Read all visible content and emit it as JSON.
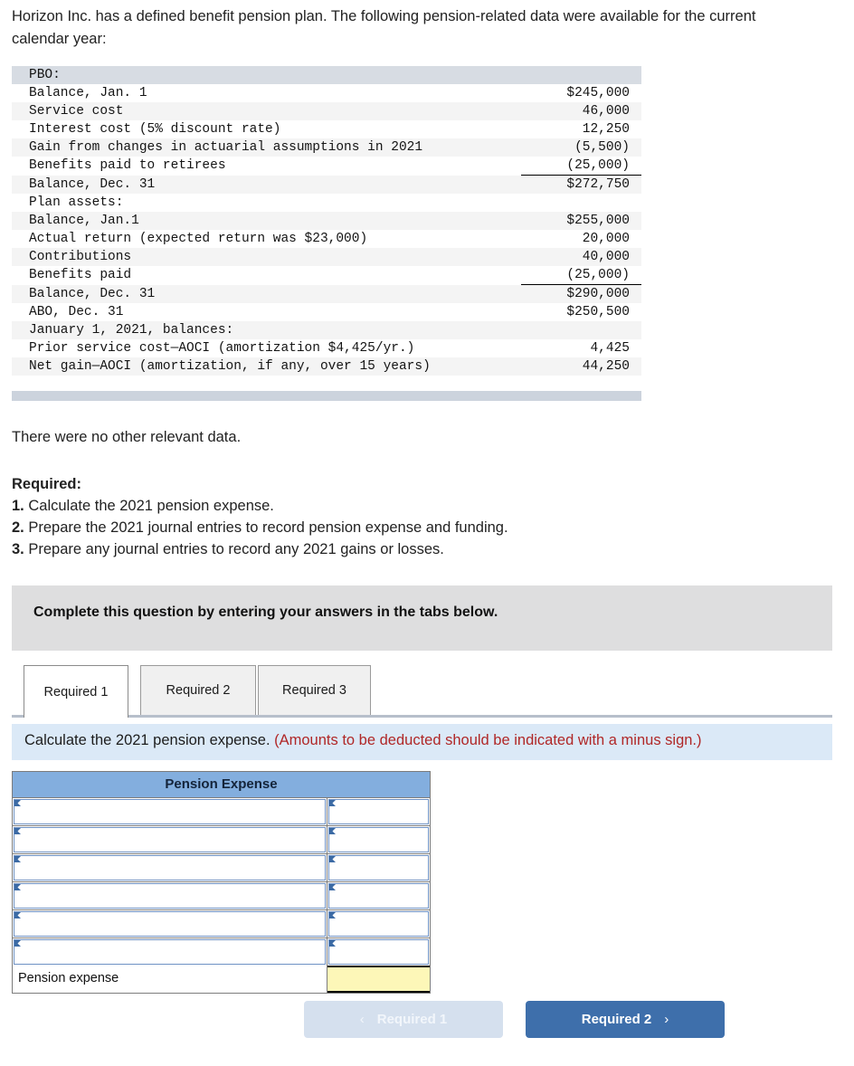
{
  "intro": "Horizon Inc. has a defined benefit pension plan. The following pension-related data were available for the current calendar year:",
  "data_table": {
    "rows": [
      {
        "label": "PBO:",
        "value": "",
        "band": "dark",
        "ruled": false
      },
      {
        "label": "Balance, Jan. 1",
        "value": "$245,000",
        "band": "white",
        "ruled": false
      },
      {
        "label": "Service cost",
        "value": "46,000",
        "band": "light",
        "ruled": false
      },
      {
        "label": "Interest cost (5% discount rate)",
        "value": "12,250",
        "band": "white",
        "ruled": false
      },
      {
        "label": "Gain from changes in actuarial assumptions in 2021",
        "value": "(5,500)",
        "band": "light",
        "ruled": false
      },
      {
        "label": "Benefits paid to retirees",
        "value": "(25,000)",
        "band": "white",
        "ruled": true
      },
      {
        "label": "Balance, Dec. 31",
        "value": "$272,750",
        "band": "light",
        "ruled": false
      },
      {
        "label": "Plan assets:",
        "value": "",
        "band": "white",
        "ruled": false
      },
      {
        "label": "Balance, Jan.1",
        "value": "$255,000",
        "band": "light",
        "ruled": false
      },
      {
        "label": "Actual return (expected return was $23,000)",
        "value": "20,000",
        "band": "white",
        "ruled": false
      },
      {
        "label": "Contributions",
        "value": "40,000",
        "band": "light",
        "ruled": false
      },
      {
        "label": "Benefits paid",
        "value": "(25,000)",
        "band": "white",
        "ruled": true
      },
      {
        "label": "Balance, Dec. 31",
        "value": "$290,000",
        "band": "light",
        "ruled": false
      },
      {
        "label": "ABO, Dec. 31",
        "value": "$250,500",
        "band": "white",
        "ruled": false
      },
      {
        "label": "January 1, 2021, balances:",
        "value": "",
        "band": "light",
        "ruled": false
      },
      {
        "label": "Prior service cost—AOCI (amortization $4,425/yr.)",
        "value": "4,425",
        "band": "white",
        "ruled": false
      },
      {
        "label": "Net gain—AOCI (amortization, if any, over 15 years)",
        "value": "44,250",
        "band": "light",
        "ruled": false
      }
    ]
  },
  "note": "There were no other relevant data.",
  "required": {
    "heading": "Required:",
    "items": [
      {
        "num": "1.",
        "text": "Calculate the 2021 pension expense."
      },
      {
        "num": "2.",
        "text": "Prepare the 2021 journal entries to record pension expense and funding."
      },
      {
        "num": "3.",
        "text": "Prepare any journal entries to record any 2021 gains or losses."
      }
    ]
  },
  "complete_bar": {
    "text": "Complete this question by entering your answers in the tabs below."
  },
  "tabs": [
    {
      "label": "Required 1",
      "active": true
    },
    {
      "label": "Required 2",
      "active": false
    },
    {
      "label": "Required 3",
      "active": false
    }
  ],
  "instruction": {
    "black": "Calculate the 2021 pension expense.",
    "red": "(Amounts to be deducted should be indicated with a minus sign.)"
  },
  "answer_grid": {
    "header": "Pension Expense",
    "input_rows": 6,
    "total_label": "Pension expense",
    "total_value": ""
  },
  "nav": {
    "prev_label": "Required 1",
    "prev_chevron": "‹",
    "next_label": "Required 2",
    "next_chevron": "›"
  },
  "colors": {
    "header_blue": "#83aede",
    "total_yellow": "#fdf7b8",
    "instruction_blue": "#dbe9f7",
    "red_text": "#b02727",
    "next_button": "#3e6fab"
  }
}
